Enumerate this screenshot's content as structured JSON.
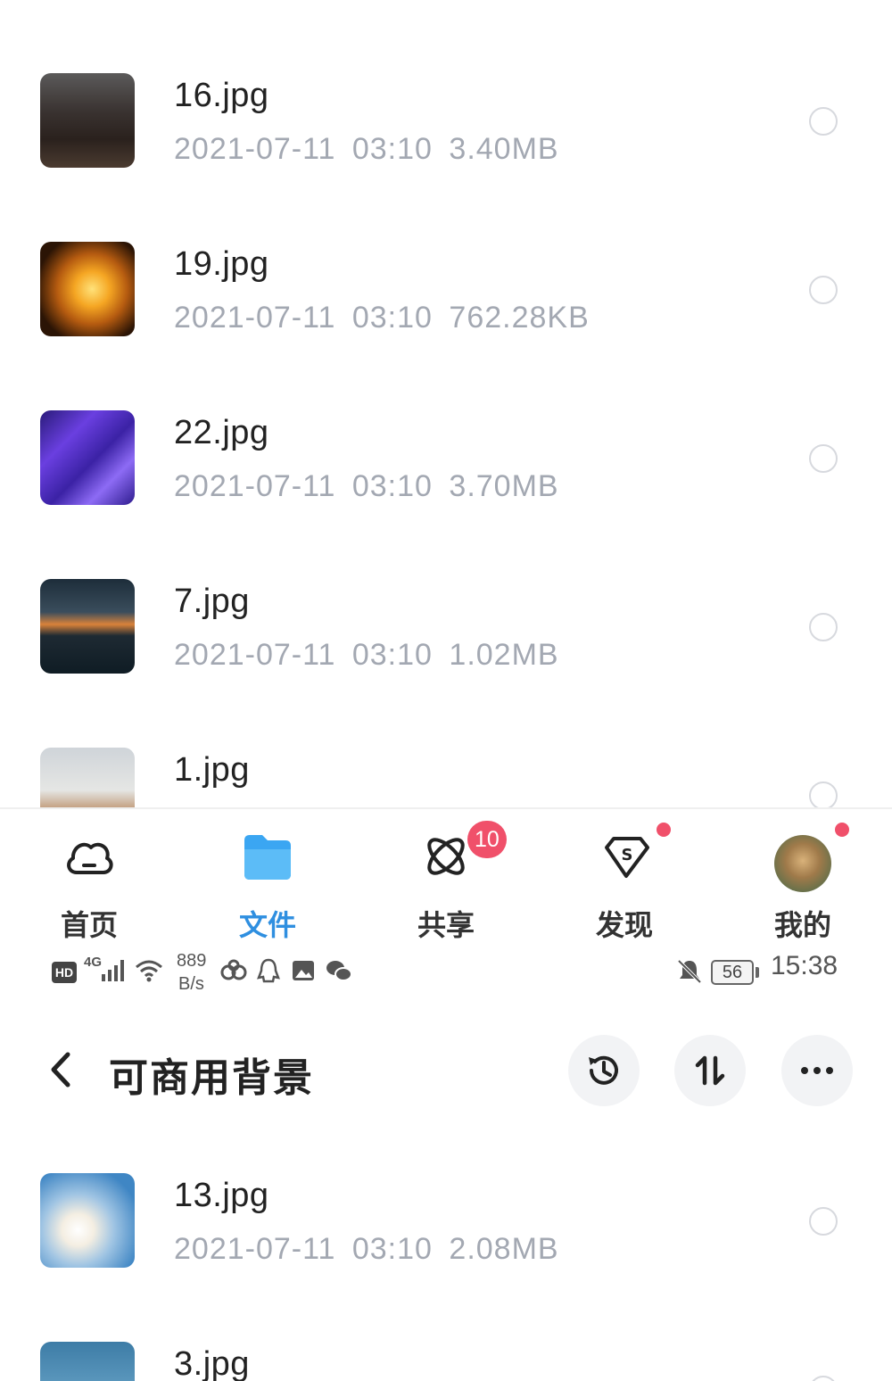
{
  "top_files": [
    {
      "name": "16.jpg",
      "date": "2021-07-11",
      "time": "03:10",
      "size": "3.40MB"
    },
    {
      "name": "19.jpg",
      "date": "2021-07-11",
      "time": "03:10",
      "size": "762.28KB"
    },
    {
      "name": "22.jpg",
      "date": "2021-07-11",
      "time": "03:10",
      "size": "3.70MB"
    },
    {
      "name": "7.jpg",
      "date": "2021-07-11",
      "time": "03:10",
      "size": "1.02MB"
    },
    {
      "name": "1.jpg"
    }
  ],
  "bottom_nav": {
    "items": [
      {
        "label": "首页",
        "icon": "cloud-icon"
      },
      {
        "label": "文件",
        "icon": "folder-icon",
        "active": true
      },
      {
        "label": "共享",
        "icon": "share-atom-icon",
        "badge": "10"
      },
      {
        "label": "发现",
        "icon": "discover-diamond-icon"
      },
      {
        "label": "我的",
        "icon": "avatar"
      }
    ]
  },
  "status_bar": {
    "hd": "HD",
    "network": "4G",
    "speed_value": "889",
    "speed_unit": "B/s",
    "battery": "56",
    "time": "15:38"
  },
  "header": {
    "title": "可商用背景"
  },
  "bottom_files": [
    {
      "name": "13.jpg",
      "date": "2021-07-11",
      "time": "03:10",
      "size": "2.08MB"
    },
    {
      "name": "3.jpg"
    }
  ],
  "colors": {
    "accent": "#2f8fe0",
    "badge": "#f0506a",
    "meta_text": "#a3a8b2"
  }
}
